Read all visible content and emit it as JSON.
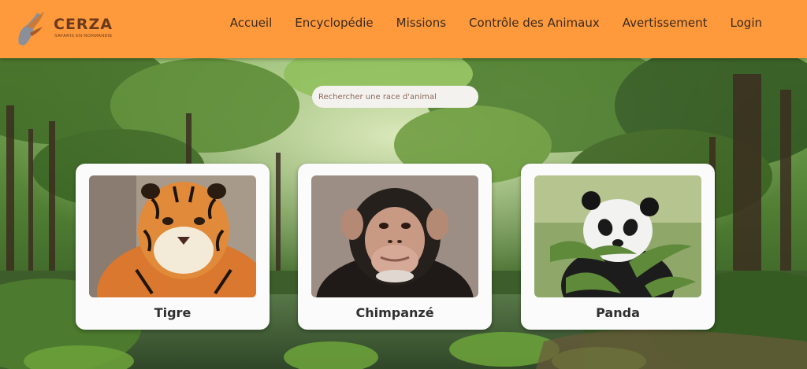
{
  "header": {
    "logo_name": "CERZA",
    "logo_tagline": "SAFARIS EN NORMANDIE",
    "nav": [
      "Accueil",
      "Encyclopédie",
      "Missions",
      "Contrôle des Animaux",
      "Avertissement",
      "Login"
    ]
  },
  "search": {
    "placeholder": "Rechercher une race d'animal"
  },
  "cards": [
    {
      "name": "Tigre"
    },
    {
      "name": "Chimpanzé"
    },
    {
      "name": "Panda"
    }
  ],
  "colors": {
    "header_bg": "#FF9A3C",
    "text_dark": "#3a2a1e",
    "card_bg": "#fbfbfb"
  }
}
